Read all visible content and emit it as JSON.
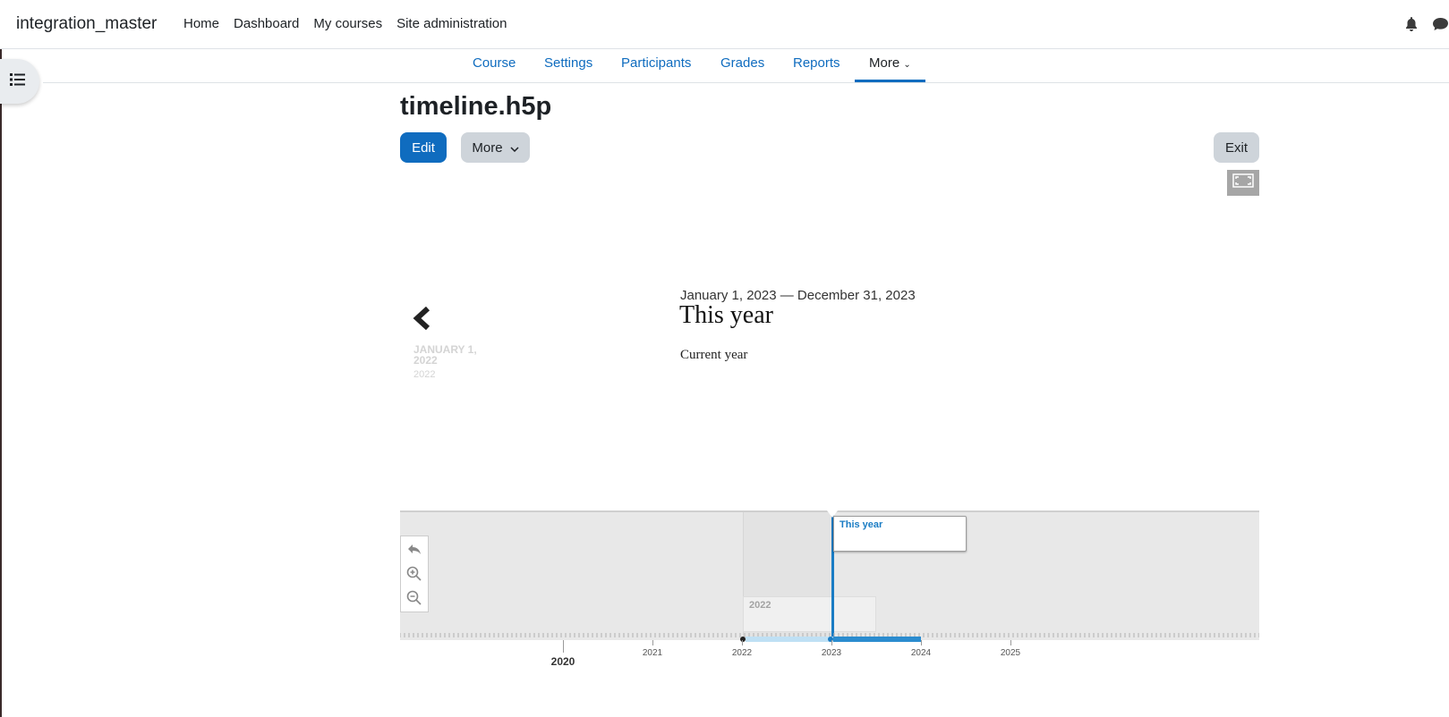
{
  "navbar": {
    "brand": "integration_master",
    "links": [
      "Home",
      "Dashboard",
      "My courses",
      "Site administration"
    ],
    "icons": [
      "bell-icon",
      "chat-icon"
    ]
  },
  "secondary_nav": {
    "items": [
      "Course",
      "Settings",
      "Participants",
      "Grades",
      "Reports"
    ],
    "more": "More"
  },
  "page": {
    "title": "timeline.h5p",
    "edit": "Edit",
    "more": "More",
    "exit": "Exit"
  },
  "slide": {
    "prev_date": "JANUARY 1, 2022",
    "prev_year": "2022",
    "date_range": "January 1, 2023 — December 31, 2023",
    "title": "This year",
    "text": "Current year"
  },
  "timeline": {
    "flag_active": "This year",
    "flag_inactive": "2022",
    "major_label": "2020",
    "years": [
      "2021",
      "2022",
      "2023",
      "2024",
      "2025"
    ],
    "accent": "#1a7cc4"
  }
}
